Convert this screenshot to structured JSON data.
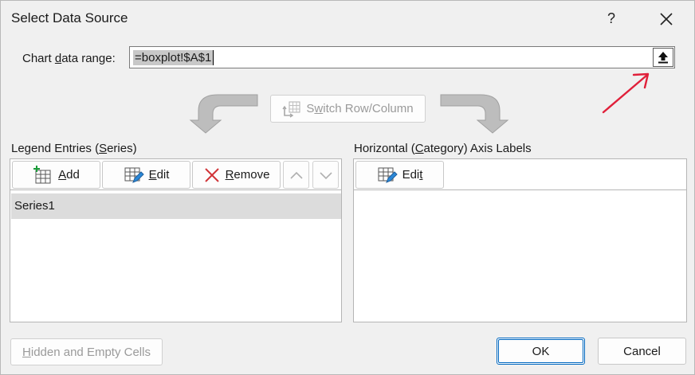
{
  "window": {
    "title": "Select Data Source",
    "help_label": "?"
  },
  "range": {
    "label_pre": "Chart ",
    "label_key": "d",
    "label_post": "ata range:",
    "value": "=boxplot!$A$1"
  },
  "switch_button": {
    "key": "w",
    "pre": "S",
    "post": "itch Row/Column"
  },
  "legend": {
    "heading_pre": "Legend Entries (",
    "heading_key": "S",
    "heading_post": "eries)",
    "add_key": "A",
    "add_post": "dd",
    "edit_key": "E",
    "edit_post": "dit",
    "remove_key": "R",
    "remove_post": "emove",
    "series": [
      "Series1"
    ]
  },
  "axis": {
    "heading_pre": "Horizontal (",
    "heading_key": "C",
    "heading_post": "ategory) Axis Labels",
    "edit_pre": "Edi",
    "edit_key": "t"
  },
  "footer": {
    "hidden_key": "H",
    "hidden_post": "idden and Empty Cells",
    "ok_label": "OK",
    "cancel_label": "Cancel"
  },
  "colors": {
    "accent": "#0067c0",
    "annotation_arrow": "#e0203a",
    "remove_icon": "#d13438"
  }
}
